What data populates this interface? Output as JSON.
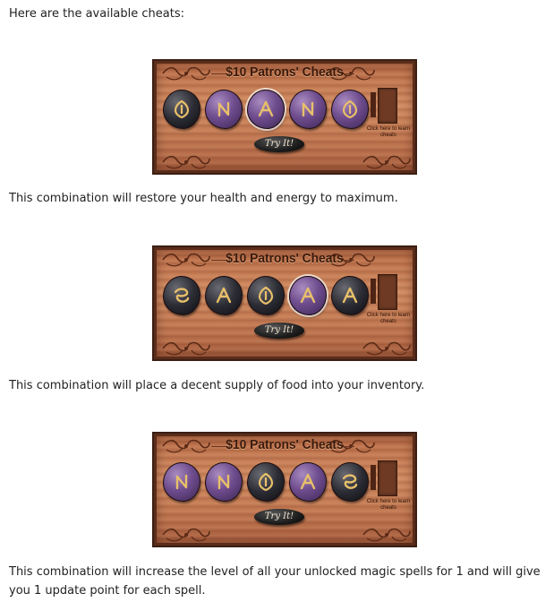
{
  "intro": "Here are the available cheats:",
  "panel_title": "$10 Patrons' Cheats",
  "learn_text": "Click here to learn cheats",
  "try_label": "Try It!",
  "colors": {
    "wood": "#c07650",
    "purple_stone": "#6f4d8e",
    "dark_stone": "#2c2c34",
    "rune_gold": "#e8c06a"
  },
  "cheats": [
    {
      "description": "This combination will restore your health and energy to maximum.",
      "stones": [
        {
          "color": "dark",
          "icon": "shield-rune-icon",
          "selected": false
        },
        {
          "color": "purple",
          "icon": "n-rune-icon",
          "selected": false
        },
        {
          "color": "purple",
          "icon": "a-rune-icon",
          "selected": true
        },
        {
          "color": "purple",
          "icon": "n-rune-icon",
          "selected": false
        },
        {
          "color": "purple",
          "icon": "shield-rune-icon",
          "selected": false
        }
      ]
    },
    {
      "description": "This combination will place a decent supply of food into your inventory.",
      "stones": [
        {
          "color": "dark",
          "icon": "swirl-rune-icon",
          "selected": false
        },
        {
          "color": "dark",
          "icon": "a-rune-icon",
          "selected": false
        },
        {
          "color": "dark",
          "icon": "shield-rune-icon",
          "selected": false
        },
        {
          "color": "purple",
          "icon": "a-rune-icon",
          "selected": true
        },
        {
          "color": "dark",
          "icon": "a-rune-icon",
          "selected": false
        }
      ]
    },
    {
      "description": "This combination will increase the level of all your unlocked magic spells for 1 and will give you 1 update point for each spell.",
      "stones": [
        {
          "color": "purple",
          "icon": "n-rune-icon",
          "selected": false
        },
        {
          "color": "purple",
          "icon": "n-rune-icon",
          "selected": false
        },
        {
          "color": "dark",
          "icon": "shield-rune-icon",
          "selected": false
        },
        {
          "color": "purple",
          "icon": "a-rune-icon",
          "selected": false
        },
        {
          "color": "dark",
          "icon": "swirl-rune-icon",
          "selected": false
        }
      ]
    }
  ]
}
